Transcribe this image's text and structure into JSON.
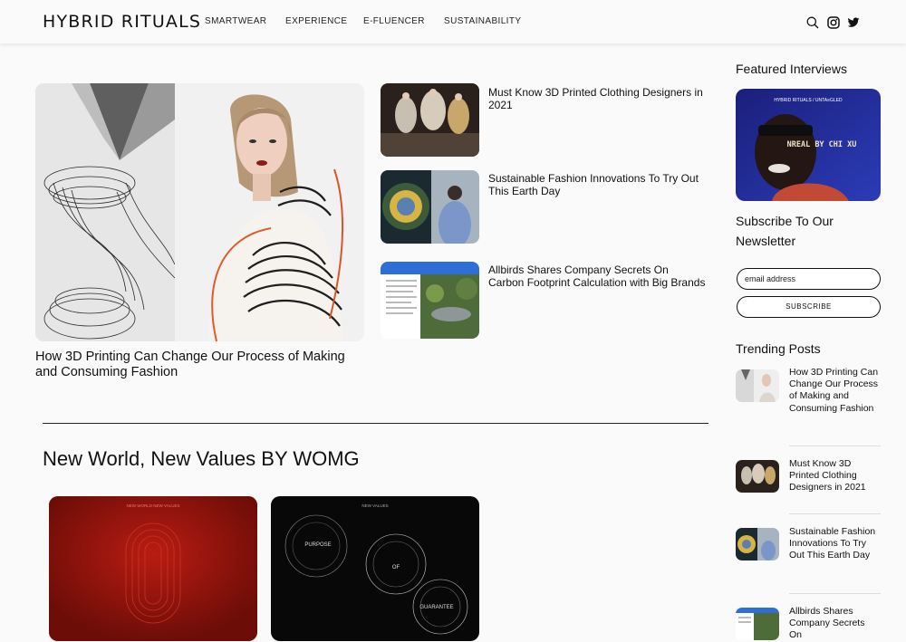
{
  "header": {
    "logo": "HYBRID RITUALS",
    "nav": [
      "SMARTWEAR",
      "EXPERIENCE",
      "E-FLUENCER",
      "SUSTAINABILITY"
    ],
    "icons": [
      "search-icon",
      "instagram-icon",
      "twitter-icon"
    ]
  },
  "hero": {
    "title": "How 3D Printing Can Change Our Process of Making and Consuming Fashion"
  },
  "side_articles": [
    {
      "title": "Must Know 3D Printed Clothing Designers in 2021"
    },
    {
      "title": "Sustainable Fashion Innovations To Try Out This Earth Day"
    },
    {
      "title": "Allbirds Shares Company Secrets On Carbon Footprint Calculation with Big Brands"
    }
  ],
  "section": {
    "title": "New World, New Values BY WOMG",
    "cards": [
      {
        "caption": "NEW WORLD NEW VALUES"
      },
      {
        "caption": "NEW VALUES",
        "bubbles": [
          "PURPOSE",
          "OF",
          "GUARANTEE"
        ]
      }
    ]
  },
  "sidebar": {
    "featured_heading": "Featured Interviews",
    "interview": {
      "brand": "HYBRID RITUALS / UNTA≡GLED",
      "name": "NREAL BY CHI XU"
    },
    "subscribe_heading": "Subscribe To Our Newsletter",
    "email_placeholder": "email address",
    "subscribe_label": "SUBSCRIBE",
    "trending_heading": "Trending Posts",
    "trending": [
      "How 3D Printing Can Change Our Process of Making and Consuming Fashion",
      "Must Know 3D Printed Clothing Designers in 2021",
      "Sustainable Fashion Innovations To Try Out This Earth Day",
      "Allbirds Shares Company Secrets On"
    ]
  },
  "colors": {
    "background": "#fafafa",
    "text": "#111111",
    "accent_red": "#a3160f"
  }
}
